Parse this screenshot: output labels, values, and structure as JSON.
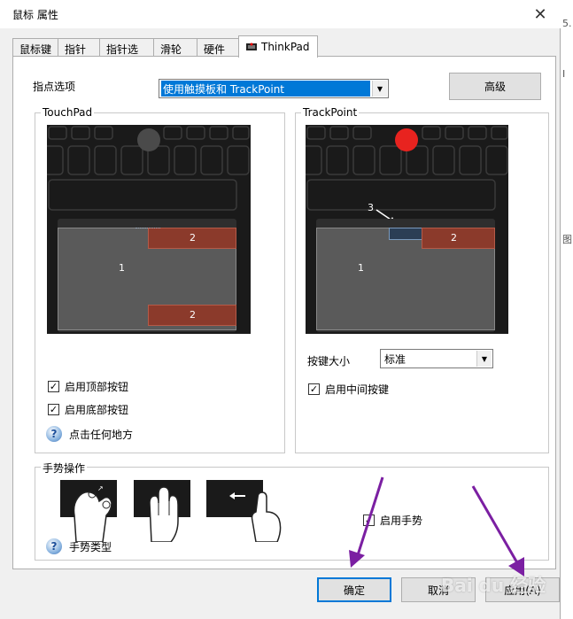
{
  "window": {
    "title": "鼠标 属性",
    "close_glyph": "✕"
  },
  "tabs": [
    {
      "label": "鼠标键"
    },
    {
      "label": "指针"
    },
    {
      "label": "指针选项"
    },
    {
      "label": "滑轮"
    },
    {
      "label": "硬件"
    },
    {
      "label": "ThinkPad"
    }
  ],
  "pointing": {
    "label": "指点选项",
    "selected": "使用触摸板和 TrackPoint",
    "advanced_button": "高级"
  },
  "touchpad": {
    "title": "TouchPad",
    "zone_main": "1",
    "zone_top": "2",
    "zone_bottom": "2",
    "enable_top_buttons": "启用顶部按钮",
    "enable_bottom_buttons": "启用底部按钮",
    "click_anywhere": "点击任何地方",
    "top_checked": true,
    "bottom_checked": true
  },
  "trackpoint": {
    "title": "TrackPoint",
    "zone_main": "1",
    "zone_right": "2",
    "zone_middle_callout": "3",
    "button_size_label": "按键大小",
    "button_size_value": "标准",
    "enable_middle_button": "启用中间按键",
    "middle_checked": true,
    "nub_color": "#e8231f"
  },
  "gestures": {
    "title": "手势操作",
    "enable_gestures": "启用手势",
    "gesture_types": "手势类型",
    "enabled_checked": true
  },
  "footer": {
    "ok": "确定",
    "cancel": "取消",
    "apply": "应用(A)"
  },
  "watermark": "Bai du 经验",
  "colors": {
    "zone_red": "#8b3a2b",
    "zone_gray": "#5a5a5a",
    "accent": "#0078d7",
    "annotation_arrow": "#7b1fa2"
  },
  "side_chars": [
    "5.",
    "I",
    "图"
  ]
}
